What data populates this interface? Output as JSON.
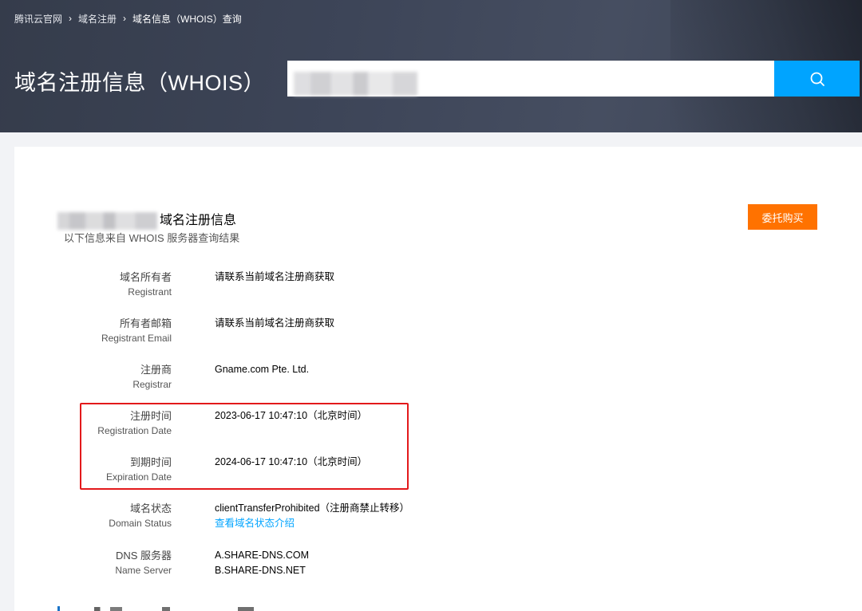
{
  "breadcrumb": {
    "home": "腾讯云官网",
    "section": "域名注册",
    "current": "域名信息（WHOIS）查询",
    "separator": "›"
  },
  "page_title": "域名注册信息（WHOIS）",
  "search": {
    "value": "",
    "button_icon": "search-icon"
  },
  "section": {
    "title": "域名注册信息",
    "subtitle": "以下信息来自 WHOIS 服务器查询结果",
    "buy_button": "委托购买"
  },
  "fields": [
    {
      "label_cn": "域名所有者",
      "label_en": "Registrant",
      "values": [
        "请联系当前域名注册商获取"
      ]
    },
    {
      "label_cn": "所有者邮箱",
      "label_en": "Registrant Email",
      "values": [
        "请联系当前域名注册商获取"
      ]
    },
    {
      "label_cn": "注册商",
      "label_en": "Registrar",
      "values": [
        "Gname.com Pte. Ltd."
      ]
    },
    {
      "label_cn": "注册时间",
      "label_en": "Registration Date",
      "values": [
        "2023-06-17 10:47:10（北京时间）"
      ]
    },
    {
      "label_cn": "到期时间",
      "label_en": "Expiration Date",
      "values": [
        "2024-06-17 10:47:10（北京时间）"
      ]
    },
    {
      "label_cn": "域名状态",
      "label_en": "Domain Status",
      "values": [
        "clientTransferProhibited（注册商禁止转移）"
      ],
      "link": "查看域名状态介绍"
    },
    {
      "label_cn": "DNS 服务器",
      "label_en": "Name Server",
      "values": [
        "A.SHARE-DNS.COM",
        "B.SHARE-DNS.NET"
      ]
    }
  ],
  "colors": {
    "accent_blue": "#00a4ff",
    "buy_orange": "#ff7200",
    "highlight_red": "#e3191b"
  }
}
